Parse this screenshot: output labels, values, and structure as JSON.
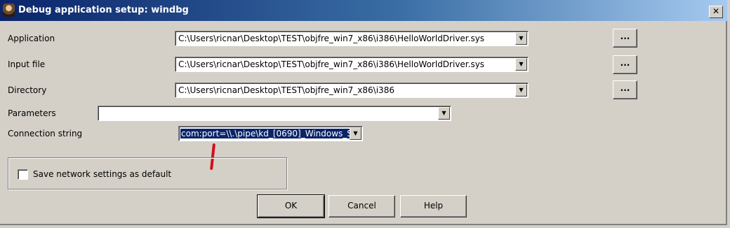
{
  "window": {
    "title": "Debug application setup: windbg",
    "close_glyph": "✕"
  },
  "fields": {
    "application": {
      "label": "Application",
      "value": "C:\\Users\\ricnar\\Desktop\\TEST\\objfre_win7_x86\\i386\\HelloWorldDriver.sys",
      "browse": "..."
    },
    "input_file": {
      "label": "Input file",
      "value": "C:\\Users\\ricnar\\Desktop\\TEST\\objfre_win7_x86\\i386\\HelloWorldDriver.sys",
      "browse": "..."
    },
    "directory": {
      "label": "Directory",
      "value": "C:\\Users\\ricnar\\Desktop\\TEST\\objfre_win7_x86\\i386",
      "browse": "..."
    },
    "parameters": {
      "label": "Parameters",
      "value": ""
    },
    "connection_string": {
      "label": "Connection string",
      "value": "com:port=\\\\.\\pipe\\kd_[0690]_Windows_S"
    }
  },
  "network": {
    "checkbox_label": "Save network settings as default",
    "checked": false
  },
  "buttons": {
    "ok": "OK",
    "cancel": "Cancel",
    "help": "Help"
  },
  "icons": {
    "dropdown": "▼"
  },
  "colors": {
    "titlebar_start": "#0a246a",
    "dialog_bg": "#d4d0c8",
    "selection": "#0a246a",
    "annotation": "#d0101a"
  }
}
